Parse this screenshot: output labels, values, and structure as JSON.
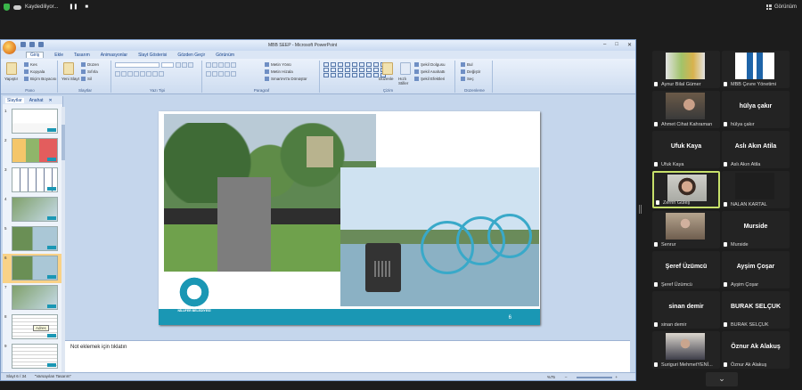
{
  "meeting": {
    "recording_label": "Kaydediliyor...",
    "view_label": "Görünüm"
  },
  "ppt": {
    "window_title": "MBB SEEP - Microsoft PowerPoint",
    "tabs": [
      "Giriş",
      "Ekle",
      "Tasarım",
      "Animasyonlar",
      "Slayt Gösterisi",
      "Gözden Geçir",
      "Görünüm"
    ],
    "ribbon": {
      "paste": "Yapıştır",
      "cut": "Kes",
      "copy": "Kopyala",
      "format_painter": "Biçim Boyacısı",
      "new_slide": "Yeni Slayt",
      "layout": "Düzen",
      "reset": "Sıfırla",
      "delete": "Sil",
      "text_direction": "Metin Yönü",
      "align_text": "Metin Hizala",
      "smartart": "SmartArt'a Dönüştür",
      "arrange": "Düzenle",
      "quick_styles": "Hızlı Stiller",
      "shape_fill": "Şekil Dolgusu",
      "shape_outline": "Şekil Anahattı",
      "shape_effects": "Şekil Efektleri",
      "find": "Bul",
      "replace": "Değiştir",
      "select": "Seç",
      "groups": [
        "Pano",
        "Slaytlar",
        "Yazı Tipi",
        "Paragraf",
        "Çizim",
        "Düzenleme"
      ]
    },
    "left_tabs": [
      "Slaytlar",
      "Anahat"
    ],
    "thumb_numbers": [
      "1",
      "2",
      "3",
      "4",
      "5",
      "6",
      "7",
      "8",
      "9"
    ],
    "tooltip": "Adres",
    "slide": {
      "logo_text": "NİLÜFER BELEDİYESİ",
      "page_number": "6"
    },
    "notes_placeholder": "Not eklemek için tıklatın",
    "status": {
      "slide_info": "Slayt 6 / 34",
      "theme": "\"Varsayılan Tasarım\"",
      "zoom": "%75"
    }
  },
  "participants": [
    {
      "display": "",
      "label": "Aynur Bilal Gümer",
      "photo": "collage"
    },
    {
      "display": "",
      "label": "MBB Çevre Yönetimi",
      "photo": "logo"
    },
    {
      "display": "",
      "label": "Ahmet Cihat Kahraman",
      "photo": "man"
    },
    {
      "display": "hülya çakır",
      "label": "hülya çakır",
      "photo": ""
    },
    {
      "display": "Ufuk Kaya",
      "label": "Ufuk Kaya",
      "photo": ""
    },
    {
      "display": "Aslı Akın Atila",
      "label": "Aslı Akın Atila",
      "photo": ""
    },
    {
      "display": "",
      "label": "Zerrin Güleş",
      "photo": "woman",
      "active": true
    },
    {
      "display": "",
      "label": "NALAN KARTAL",
      "photo": "blank"
    },
    {
      "display": "",
      "label": "Senrur",
      "photo": "person2"
    },
    {
      "display": "Murside",
      "label": "Murside",
      "photo": ""
    },
    {
      "display": "Şeref Üzümcü",
      "label": "Şeref Üzümcü",
      "photo": ""
    },
    {
      "display": "Ayşim Çoşar",
      "label": "Ayşim Çoşar",
      "photo": ""
    },
    {
      "display": "sinan demir",
      "label": "sinan demir",
      "photo": ""
    },
    {
      "display": "BURAK SELÇUK",
      "label": "BURAK SELÇUK",
      "photo": ""
    },
    {
      "display": "",
      "label": "Suriguri MehmetYENİ...",
      "photo": "man2"
    },
    {
      "display": "Öznur Ak Alakuş",
      "label": "Öznur Ak Alakuş",
      "photo": ""
    }
  ],
  "colors": {
    "accent": "#1a97b4",
    "active_border": "#c7e06a"
  }
}
